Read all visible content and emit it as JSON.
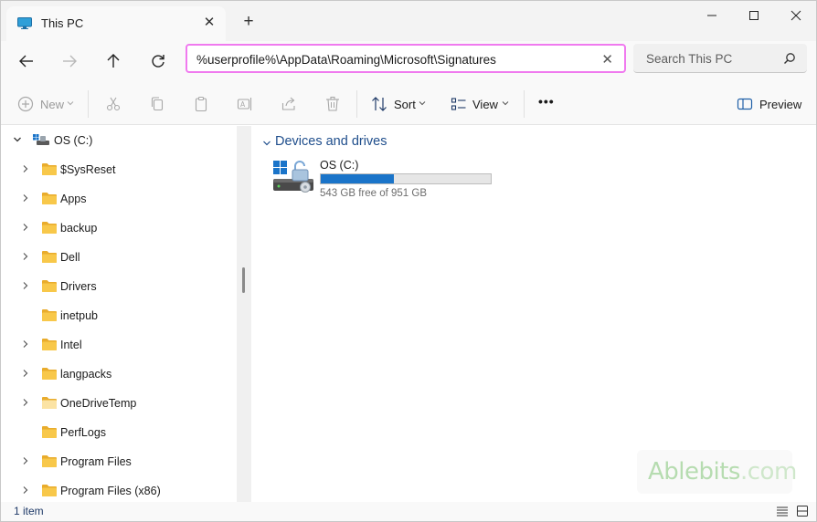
{
  "window": {
    "tab_title": "This PC",
    "tab_close": "✕",
    "new_tab": "+",
    "controls": [
      "minimize-icon",
      "maximize-icon",
      "close-icon"
    ]
  },
  "nav": {
    "buttons": [
      "back-arrow-icon",
      "forward-arrow-icon",
      "up-arrow-icon",
      "refresh-icon"
    ],
    "address": "%userprofile%\\AppData\\Roaming\\Microsoft\\Signatures",
    "address_clear": "✕",
    "search_placeholder": "Search This PC"
  },
  "commands": {
    "new": "New",
    "sort": "Sort",
    "view": "View",
    "more": "•••",
    "preview": "Preview",
    "icons": [
      "new-plus-icon",
      "cut-icon",
      "copy-icon",
      "paste-icon",
      "rename-icon",
      "share-icon",
      "delete-icon",
      "sort-icon",
      "view-icon",
      "more-icon",
      "preview-pane-icon"
    ]
  },
  "tree": {
    "root": "OS (C:)",
    "items": [
      {
        "label": "$SysReset",
        "expandable": true
      },
      {
        "label": "Apps",
        "expandable": true
      },
      {
        "label": "backup",
        "expandable": true
      },
      {
        "label": "Dell",
        "expandable": true
      },
      {
        "label": "Drivers",
        "expandable": true
      },
      {
        "label": "inetpub",
        "expandable": false
      },
      {
        "label": "Intel",
        "expandable": true
      },
      {
        "label": "langpacks",
        "expandable": true
      },
      {
        "label": "OneDriveTemp",
        "expandable": true
      },
      {
        "label": "PerfLogs",
        "expandable": false
      },
      {
        "label": "Program Files",
        "expandable": true
      },
      {
        "label": "Program Files (x86)",
        "expandable": true
      }
    ]
  },
  "content": {
    "group_title": "Devices and drives",
    "drive": {
      "name": "OS (C:)",
      "free_text": "543 GB free of 951 GB",
      "used_fraction": 0.429
    }
  },
  "watermark": {
    "part1": "Ablebits",
    "part2": ".com"
  },
  "status": {
    "item_count": "1 item"
  },
  "colors": {
    "accent": "#1a74c9",
    "address_focus": "#f07aef",
    "group_title": "#1f4e8c",
    "folder": "#f8c84a"
  }
}
